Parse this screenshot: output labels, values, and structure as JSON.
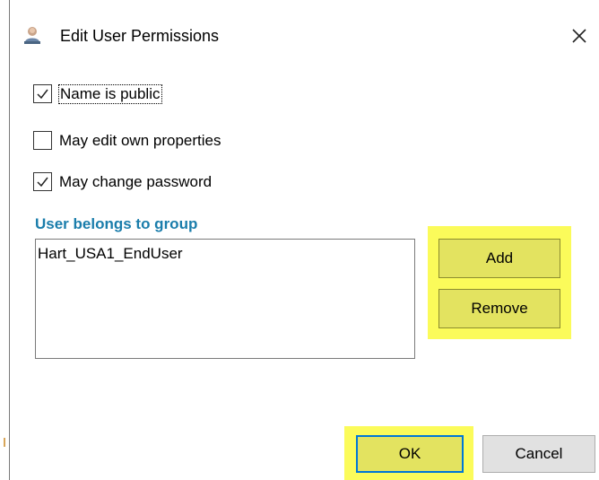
{
  "window": {
    "title": "Edit User Permissions",
    "close_icon": "close-icon",
    "title_icon": "user-permissions-icon"
  },
  "checkboxes": [
    {
      "label": "Name is public",
      "checked": true
    },
    {
      "label": "May edit own properties",
      "checked": false
    },
    {
      "label": "May change password",
      "checked": true
    }
  ],
  "groups": {
    "heading": "User belongs to group",
    "items": [
      "Hart_USA1_EndUser"
    ],
    "add_label": "Add",
    "remove_label": "Remove"
  },
  "footer": {
    "ok_label": "OK",
    "cancel_label": "Cancel"
  },
  "colors": {
    "heading": "#1a7dab",
    "highlight": "#fbfb5a",
    "button_face": "#e1e1e1",
    "focus_border": "#0078d7"
  }
}
